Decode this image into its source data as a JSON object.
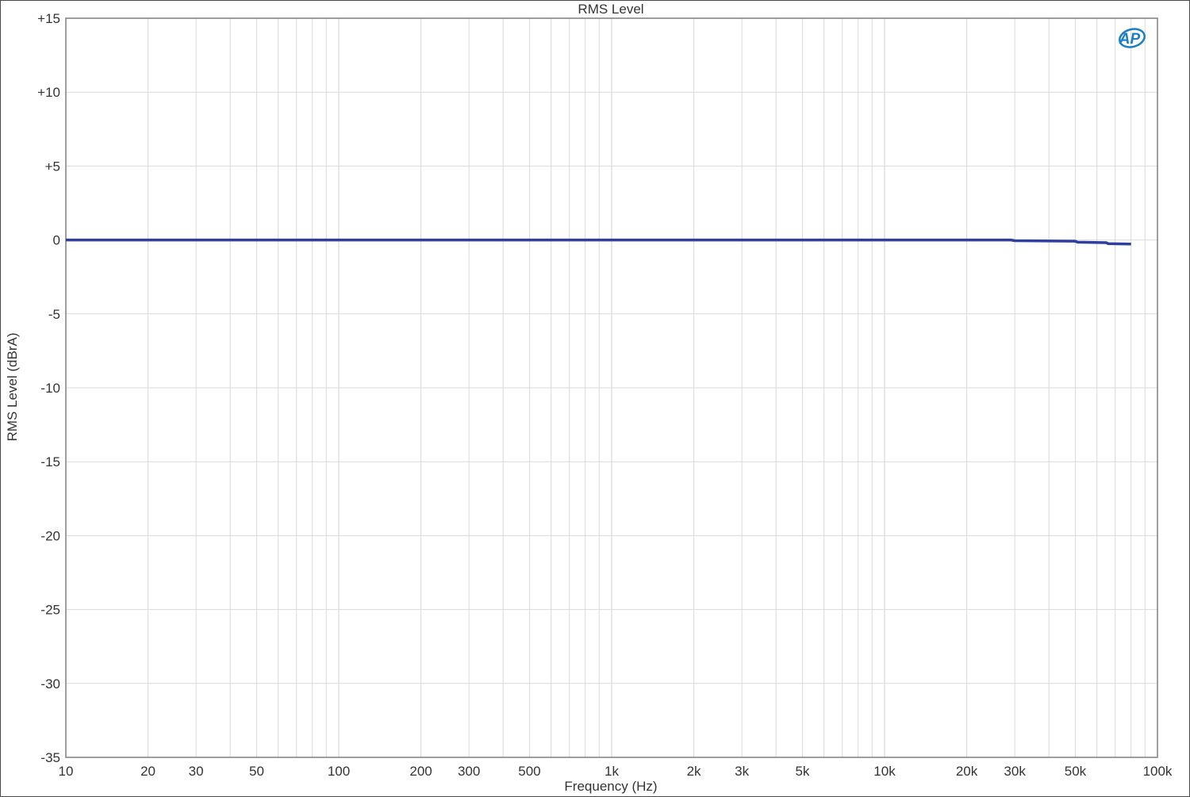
{
  "chart_data": {
    "type": "line",
    "title": "RMS Level",
    "xlabel": "Frequency (Hz)",
    "ylabel": "RMS Level (dBrA)",
    "x_scale": "log",
    "xlim": [
      10,
      100000
    ],
    "ylim": [
      -35,
      15
    ],
    "grid": true,
    "x_ticks": [
      {
        "value": 10,
        "label": "10"
      },
      {
        "value": 20,
        "label": "20"
      },
      {
        "value": 30,
        "label": "30"
      },
      {
        "value": 50,
        "label": "50"
      },
      {
        "value": 100,
        "label": "100"
      },
      {
        "value": 200,
        "label": "200"
      },
      {
        "value": 300,
        "label": "300"
      },
      {
        "value": 500,
        "label": "500"
      },
      {
        "value": 1000,
        "label": "1k"
      },
      {
        "value": 2000,
        "label": "2k"
      },
      {
        "value": 3000,
        "label": "3k"
      },
      {
        "value": 5000,
        "label": "5k"
      },
      {
        "value": 10000,
        "label": "10k"
      },
      {
        "value": 20000,
        "label": "20k"
      },
      {
        "value": 30000,
        "label": "30k"
      },
      {
        "value": 50000,
        "label": "50k"
      },
      {
        "value": 100000,
        "label": "100k"
      }
    ],
    "y_ticks": [
      {
        "value": 15,
        "label": "+15"
      },
      {
        "value": 10,
        "label": "+10"
      },
      {
        "value": 5,
        "label": "+5"
      },
      {
        "value": 0,
        "label": "0"
      },
      {
        "value": -5,
        "label": "-5"
      },
      {
        "value": -10,
        "label": "-10"
      },
      {
        "value": -15,
        "label": "-15"
      },
      {
        "value": -20,
        "label": "-20"
      },
      {
        "value": -25,
        "label": "-25"
      },
      {
        "value": -30,
        "label": "-30"
      },
      {
        "value": -35,
        "label": "-35"
      }
    ],
    "series": [
      {
        "color": "#2e3f9e",
        "points": [
          [
            10,
            0.0
          ],
          [
            50,
            0.0
          ],
          [
            100,
            0.0
          ],
          [
            500,
            0.0
          ],
          [
            1000,
            0.0
          ],
          [
            5000,
            0.0
          ],
          [
            10000,
            0.0
          ],
          [
            20000,
            0.0
          ],
          [
            29000,
            0.0
          ],
          [
            30000,
            -0.05
          ],
          [
            50000,
            -0.08
          ],
          [
            51000,
            -0.15
          ],
          [
            65000,
            -0.18
          ],
          [
            66000,
            -0.25
          ],
          [
            80000,
            -0.28
          ]
        ]
      }
    ]
  },
  "logo": {
    "text": "AP",
    "color": "#1a7fc1"
  },
  "colors": {
    "grid": "#d9d9d9",
    "axis": "#7f7f7f",
    "line": "#2e3f9e"
  }
}
